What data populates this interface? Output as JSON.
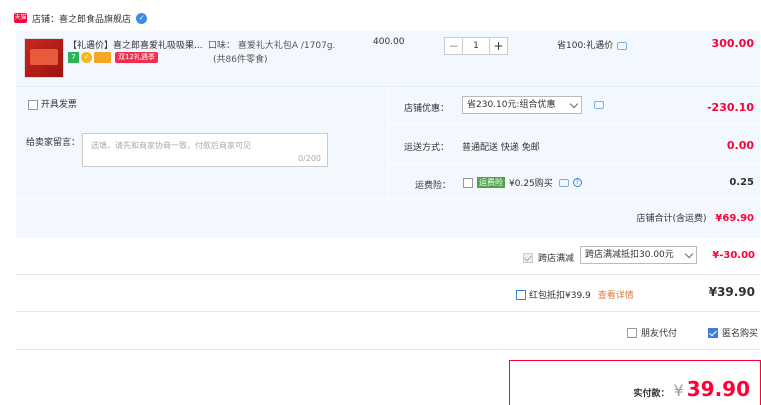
{
  "shop": {
    "badge": "天猫",
    "label": "店铺：",
    "name": "喜之郎食品旗舰店",
    "ww_icon": "wangwang-icon"
  },
  "product": {
    "title": "【礼遇价】喜之郎喜爱礼吸吸果...",
    "flavor": "口味：  喜爱礼大礼包A /1707g.",
    "flavor_sub": "(共86件零食)",
    "tag_green": "7",
    "tag_promo": "双12礼遇季",
    "unit_price": "400.00",
    "qty": "1",
    "qty_minus": "−",
    "qty_plus": "+",
    "save_text": "省100:礼遇价",
    "subtotal": "300.00"
  },
  "invoice": {
    "label": "开具发票"
  },
  "memo": {
    "label": "给卖家留言：",
    "placeholder": "选填，请先和商家协商一致，付款后商家可见",
    "count": "0/200"
  },
  "shop_discount": {
    "label": "店铺优惠：",
    "selected": "省230.10元:组合优惠",
    "amount": "-230.10"
  },
  "delivery": {
    "label": "运送方式：",
    "value": "普通配送 快递 免邮",
    "amount": "0.00"
  },
  "freight_insurance": {
    "label": "运费险：",
    "tag": "运费险",
    "value": "¥0.25购买",
    "help": "?",
    "amount": "0.25"
  },
  "shop_total": {
    "label": "店铺合计(含运费)",
    "amount": "¥69.90"
  },
  "cross_store": {
    "label": "跨店满减",
    "selected": "跨店满减抵扣30.00元",
    "amount": "¥-30.00"
  },
  "red_packet": {
    "label": "红包抵扣¥39.9",
    "link": "查看详情",
    "amount": "¥39.90"
  },
  "friend_pay": {
    "label": "朋友代付"
  },
  "anonymous": {
    "label": "匿名购买"
  },
  "payment": {
    "label": "实付款：",
    "currency": "¥",
    "amount": "39.90"
  },
  "colors": {
    "accent_red": "#ff0036",
    "row_bg": "#f3f8fe",
    "checkbox_blue": "#3b7de0"
  }
}
